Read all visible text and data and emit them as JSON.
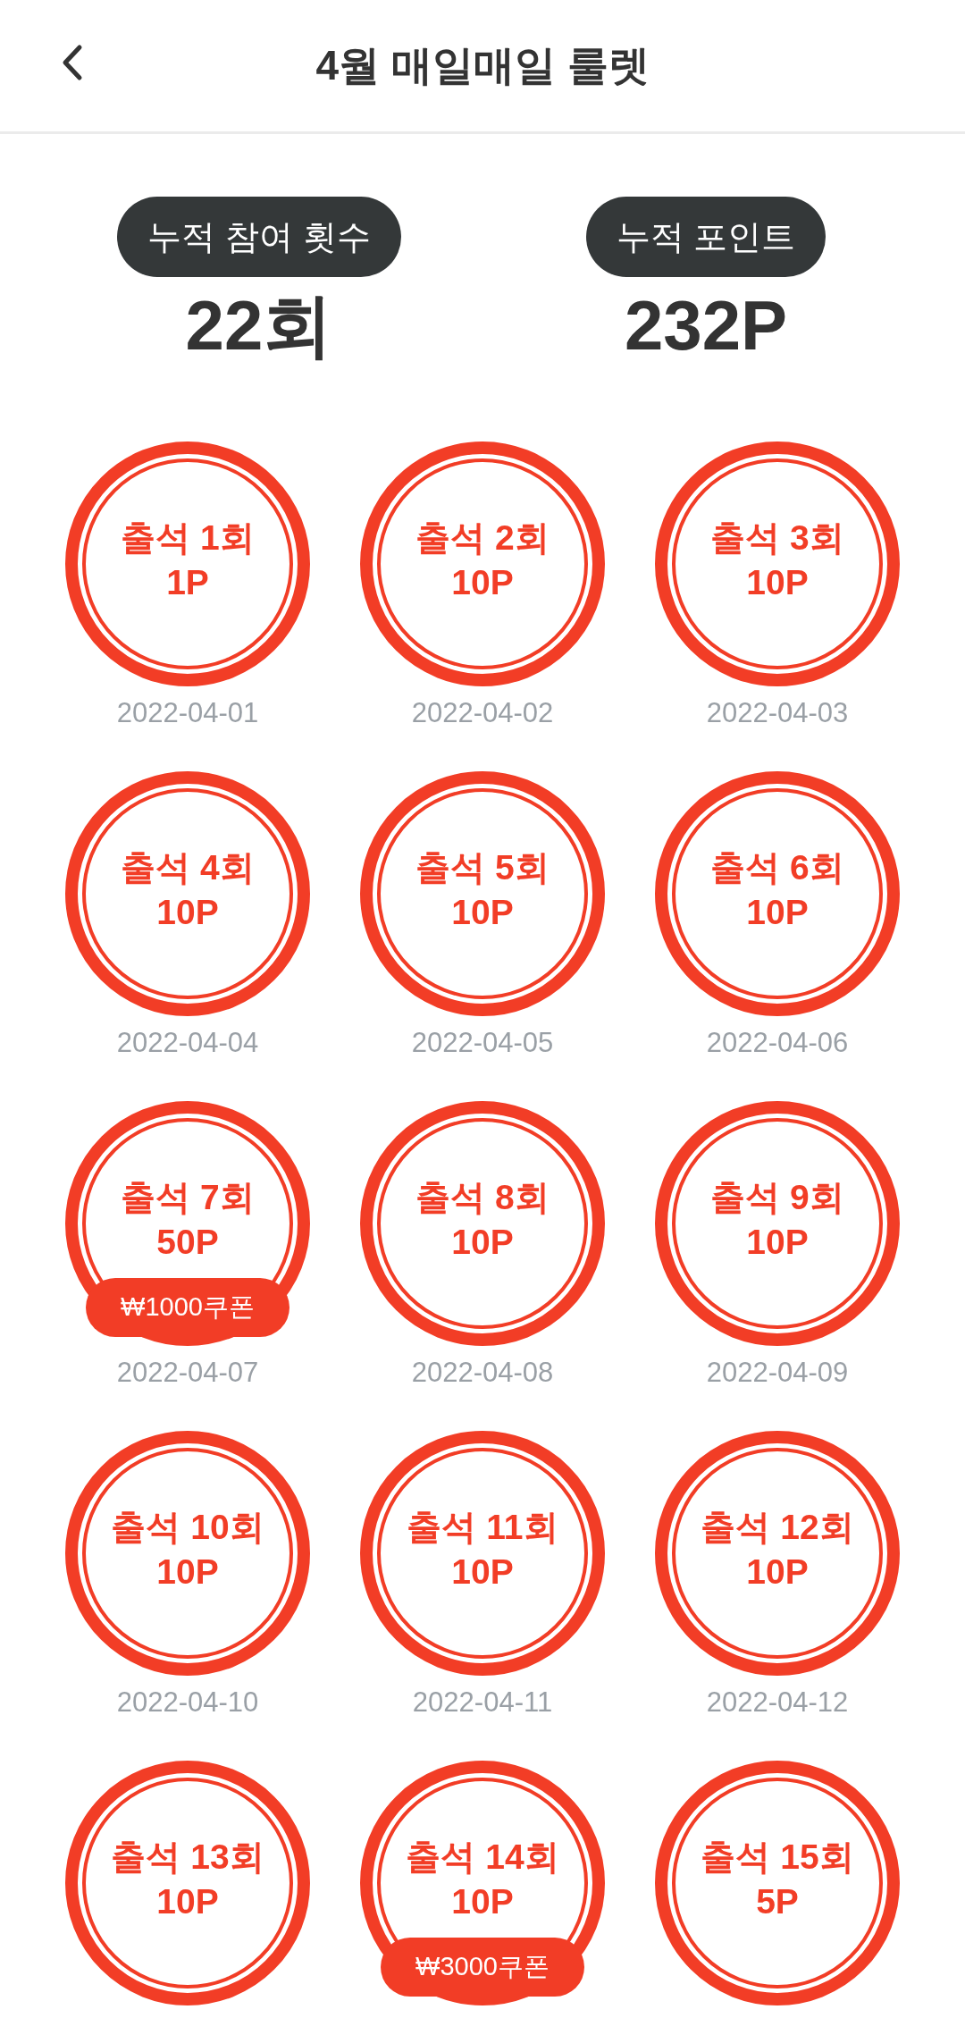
{
  "header": {
    "title": "4월 매일매일 룰렛"
  },
  "stats": [
    {
      "label": "누적 참여 횟수",
      "value": "22회"
    },
    {
      "label": "누적 포인트",
      "value": "232P"
    }
  ],
  "stamps": [
    {
      "title": "출석 1회",
      "points": "1P",
      "date": "2022-04-01"
    },
    {
      "title": "출석 2회",
      "points": "10P",
      "date": "2022-04-02"
    },
    {
      "title": "출석 3회",
      "points": "10P",
      "date": "2022-04-03"
    },
    {
      "title": "출석 4회",
      "points": "10P",
      "date": "2022-04-04"
    },
    {
      "title": "출석 5회",
      "points": "10P",
      "date": "2022-04-05"
    },
    {
      "title": "출석 6회",
      "points": "10P",
      "date": "2022-04-06"
    },
    {
      "title": "출석 7회",
      "points": "50P",
      "date": "2022-04-07",
      "coupon": "₩1000쿠폰"
    },
    {
      "title": "출석 8회",
      "points": "10P",
      "date": "2022-04-08"
    },
    {
      "title": "출석 9회",
      "points": "10P",
      "date": "2022-04-09"
    },
    {
      "title": "출석 10회",
      "points": "10P",
      "date": "2022-04-10"
    },
    {
      "title": "출석 11회",
      "points": "10P",
      "date": "2022-04-11"
    },
    {
      "title": "출석 12회",
      "points": "10P",
      "date": "2022-04-12"
    },
    {
      "title": "출석 13회",
      "points": "10P"
    },
    {
      "title": "출석 14회",
      "points": "10P",
      "coupon": "₩3000쿠폰"
    },
    {
      "title": "출석 15회",
      "points": "5P"
    }
  ]
}
